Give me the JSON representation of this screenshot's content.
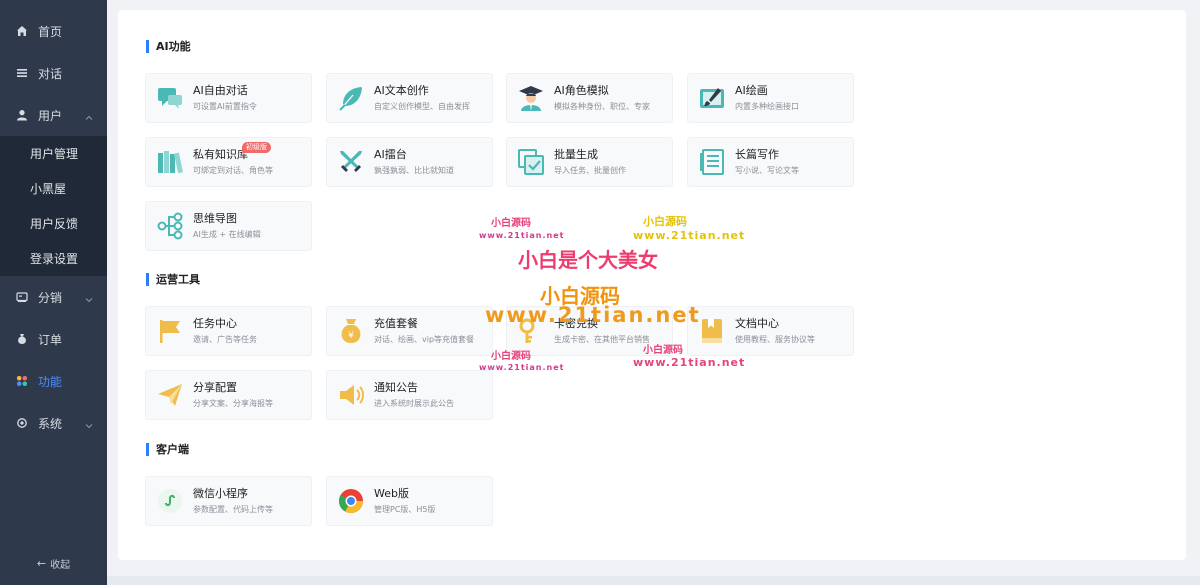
{
  "sidebar": {
    "items": [
      {
        "label": "首页",
        "icon": "home-icon"
      },
      {
        "label": "对话",
        "icon": "list-icon"
      },
      {
        "label": "用户",
        "icon": "user-icon",
        "expanded": true
      },
      {
        "label": "分销",
        "icon": "distribution-icon"
      },
      {
        "label": "订单",
        "icon": "money-bag-icon"
      },
      {
        "label": "功能",
        "icon": "apps-icon",
        "active": true
      },
      {
        "label": "系统",
        "icon": "settings-icon"
      }
    ],
    "user_sub": [
      "用户管理",
      "小黑屋",
      "用户反馈",
      "登录设置"
    ],
    "collapse_label": "收起",
    "active_color": "#4d8dff",
    "bg_color": "#2e3a4c"
  },
  "sections": {
    "ai": {
      "title": "AI功能",
      "cards": [
        {
          "title": "AI自由对话",
          "desc": "可设置AI前置指令",
          "icon": "chat-icon"
        },
        {
          "title": "AI文本创作",
          "desc": "自定义创作模型、自由发挥",
          "icon": "feather-icon"
        },
        {
          "title": "AI角色模拟",
          "desc": "模拟各种身份、职位、专家",
          "icon": "graduate-icon"
        },
        {
          "title": "AI绘画",
          "desc": "内置多种绘画接口",
          "icon": "paint-icon"
        },
        {
          "title": "私有知识库",
          "desc": "可绑定到对话、角色等",
          "icon": "books-icon",
          "badge": "初级版"
        },
        {
          "title": "AI擂台",
          "desc": "孰强孰弱、比比就知道",
          "icon": "swords-icon"
        },
        {
          "title": "批量生成",
          "desc": "导入任务、批量创作",
          "icon": "batch-icon"
        },
        {
          "title": "长篇写作",
          "desc": "写小说、写论文等",
          "icon": "document-icon"
        },
        {
          "title": "思维导图",
          "desc": "AI生成 + 在线编辑",
          "icon": "mindmap-icon"
        }
      ]
    },
    "ops": {
      "title": "运营工具",
      "cards": [
        {
          "title": "任务中心",
          "desc": "邀请、广告等任务",
          "icon": "flag-icon"
        },
        {
          "title": "充值套餐",
          "desc": "对话、绘画、vip等充值套餐",
          "icon": "moneybag-icon"
        },
        {
          "title": "卡密兑换",
          "desc": "生成卡密、在其他平台销售",
          "icon": "key-icon"
        },
        {
          "title": "文档中心",
          "desc": "使用教程、服务协议等",
          "icon": "book-icon"
        },
        {
          "title": "分享配置",
          "desc": "分享文案、分享海报等",
          "icon": "paper-plane-icon"
        },
        {
          "title": "通知公告",
          "desc": "进入系统时展示此公告",
          "icon": "speaker-icon"
        }
      ]
    },
    "client": {
      "title": "客户端",
      "cards": [
        {
          "title": "微信小程序",
          "desc": "参数配置、代码上传等",
          "icon": "miniprogram-icon"
        },
        {
          "title": "Web版",
          "desc": "管理PC版、H5版",
          "icon": "chrome-icon"
        }
      ]
    }
  },
  "watermark": {
    "small1": "小白源码",
    "url1": "www.21tian.net",
    "small2": "小白源码",
    "url2": "www.21tian.net",
    "big": "小白是个大美女",
    "brand": "小白源码",
    "bigurl": "www.21tian.net",
    "small3": "小白源码",
    "url3": "www.21tian.net",
    "small4": "小白源码",
    "url4": "www.21tian.net"
  },
  "colors": {
    "accent": "#2b7fff",
    "icon_teal": "#4ab8b5",
    "icon_yellow": "#f0bd4a",
    "badge": "#f06a6a"
  }
}
